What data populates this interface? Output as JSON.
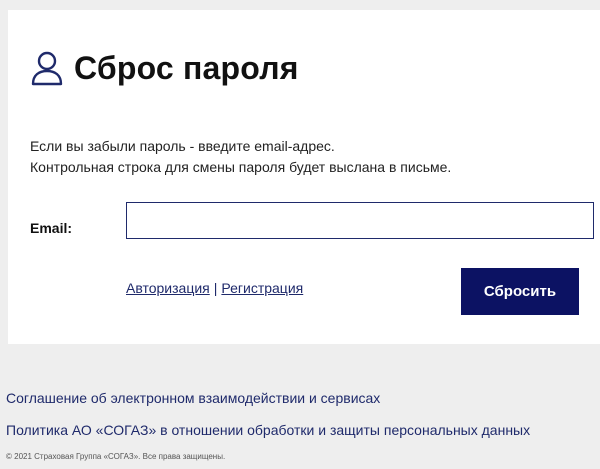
{
  "form": {
    "title": "Сброс пароля",
    "title_icon": "user-icon",
    "description_line1": "Если вы забыли пароль - введите email-адрес.",
    "description_line2": "Контрольная строка для смены пароля будет выслана в письме.",
    "email_label": "Email:",
    "email_value": "",
    "email_placeholder": "",
    "link_auth": "Авторизация",
    "link_separator": "|",
    "link_register": "Регистрация",
    "submit_label": "Сбросить"
  },
  "footer": {
    "agreement_link": "Соглашение об электронном взаимодействии и сервисах",
    "policy_link": "Политика АО «СОГАЗ» в отношении обработки и защиты персональных данных",
    "copyright": "© 2021 Страховая Группа «СОГАЗ». Все права защищены."
  },
  "colors": {
    "accent": "#0c1263",
    "link": "#1f2a6b",
    "background": "#eeeeee",
    "card": "#ffffff"
  }
}
